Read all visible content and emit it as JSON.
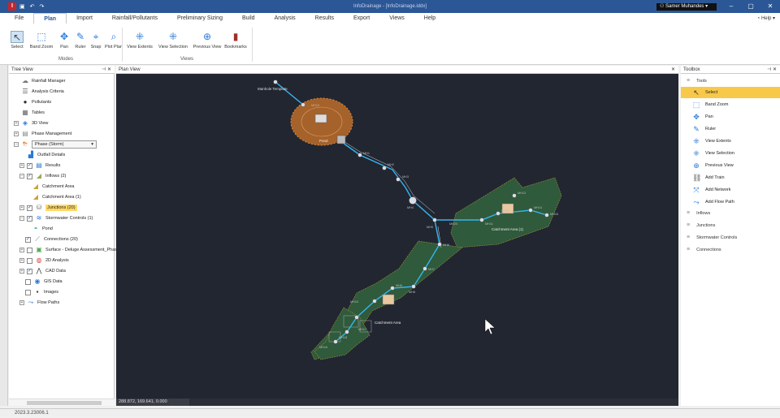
{
  "titlebar": {
    "title": "InfoDrainage - [InfoDrainage.iddx]",
    "user": "Samer Muhandes"
  },
  "menu": {
    "items": [
      "File",
      "Plan",
      "Import",
      "Rainfall/Pollutants",
      "Preliminary Sizing",
      "Build",
      "Analysis",
      "Results",
      "Export",
      "Views",
      "Help"
    ],
    "active": "Plan",
    "help": "Help"
  },
  "ribbon": {
    "modes_label": "Modes",
    "views_label": "Views",
    "modes": [
      {
        "label": "Select",
        "icon": "cursor-icon"
      },
      {
        "label": "Band Zoom",
        "icon": "band-zoom-icon"
      },
      {
        "label": "Pan",
        "icon": "pan-icon"
      },
      {
        "label": "Ruler",
        "icon": "ruler-icon"
      },
      {
        "label": "Snap",
        "icon": "snap-icon"
      },
      {
        "label": "Plot Plan",
        "icon": "plot-plan-icon"
      }
    ],
    "views": [
      {
        "label": "View Extents",
        "icon": "view-extents-icon"
      },
      {
        "label": "View Selection",
        "icon": "view-selection-icon"
      },
      {
        "label": "Previous View",
        "icon": "previous-view-icon"
      },
      {
        "label": "Bookmarks",
        "icon": "bookmarks-icon"
      }
    ]
  },
  "treeview": {
    "title": "Tree View",
    "items": [
      {
        "label": "Rainfall Manager"
      },
      {
        "label": "Analysis Criteria"
      },
      {
        "label": "Pollutants"
      },
      {
        "label": "Tables"
      },
      {
        "label": "3D View"
      },
      {
        "label": "Phase Management"
      },
      {
        "label": "Phase (Storm)"
      },
      {
        "label": "Outfall Details"
      },
      {
        "label": "Results"
      },
      {
        "label": "Inflows (2)"
      },
      {
        "label": "Catchment Area"
      },
      {
        "label": "Catchment Area (1)"
      },
      {
        "label": "Junctions (20)"
      },
      {
        "label": "Stormwater Controls (1)"
      },
      {
        "label": "Pond"
      },
      {
        "label": "Connections (20)"
      },
      {
        "label": "Surface - Deluge Assessment_Phas"
      },
      {
        "label": "2D Analysis"
      },
      {
        "label": "CAD Data"
      },
      {
        "label": "GIS Data"
      },
      {
        "label": "Images"
      },
      {
        "label": "Flow Paths"
      }
    ]
  },
  "planview": {
    "title": "Plan View",
    "coords": "288.872, 169.641, 0.000",
    "labels": {
      "manhole": "Manhole Template",
      "pond": "Pond",
      "ca1": "Catchment Area (1)",
      "ca": "Catchment Area"
    },
    "nodes": [
      "MH1",
      "MH2",
      "MH3",
      "MH4",
      "MH5",
      "MH6",
      "MH7",
      "MH8",
      "MH9",
      "MH10",
      "MH11",
      "MH12",
      "MH13",
      "MH14",
      "MH15",
      "MH16",
      "MH17",
      "MH18",
      "MH19",
      "MH20"
    ]
  },
  "toolbox": {
    "title": "Toolbox",
    "tools_label": "Tools",
    "tools": [
      {
        "label": "Select",
        "icon": "cursor-icon",
        "selected": true
      },
      {
        "label": "Band Zoom",
        "icon": "band-zoom-icon"
      },
      {
        "label": "Pan",
        "icon": "pan-icon"
      },
      {
        "label": "Ruler",
        "icon": "ruler-icon"
      },
      {
        "label": "View Extents",
        "icon": "view-extents-icon"
      },
      {
        "label": "View Selection",
        "icon": "view-selection-icon"
      },
      {
        "label": "Previous View",
        "icon": "previous-view-icon"
      },
      {
        "label": "Add Train",
        "icon": "add-train-icon"
      },
      {
        "label": "Add Network",
        "icon": "add-network-icon"
      },
      {
        "label": "Add Flow Path",
        "icon": "add-flow-path-icon"
      }
    ],
    "categories": [
      "Inflows",
      "Junctions",
      "Stormwater Controls",
      "Connections"
    ]
  },
  "status": {
    "version": "2023.3.23006.1"
  },
  "colors": {
    "titlebar": "#2b5797",
    "canvas": "#222631",
    "catchment": "#2f5a3b",
    "pond": "#b5702e",
    "pipe": "#35b6f0",
    "selected": "#f7c84a"
  }
}
